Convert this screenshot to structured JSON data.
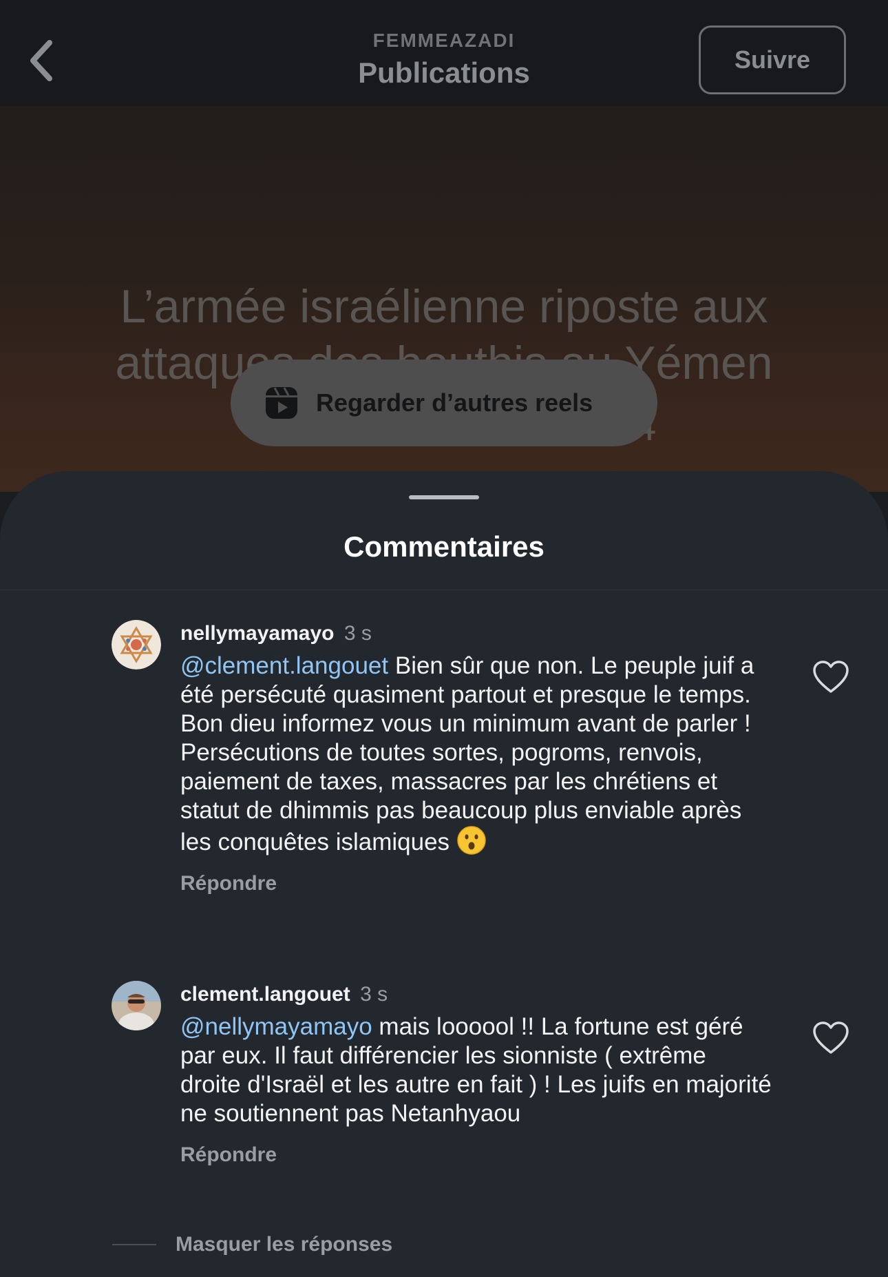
{
  "header": {
    "back_icon": "chevron-left-icon",
    "account": "FEMMEAZADI",
    "title": "Publications",
    "follow_label": "Suivre"
  },
  "video": {
    "caption_line1": "L’armée israélienne riposte aux",
    "caption_line2": "attaques des houthis au Yémen",
    "caption_extra": "4",
    "reels_icon": "reels-icon",
    "reels_label": "Regarder d’autres reels"
  },
  "comments_sheet": {
    "title": "Commentaires",
    "comments": [
      {
        "username": "nellymayamayo",
        "time": "3 s",
        "mention": "@clement.langouet",
        "text": "Bien sûr que non. Le peuple juif a été persécuté quasiment partout et presque le temps. Bon dieu informez vous un minimum avant de parler ! Persécutions de toutes sortes, pogroms, renvois, paiement de taxes, massacres par les chrétiens et statut de dhimmis pas beaucoup plus enviable après les conquêtes islamiques",
        "emoji": "astonished-face-emoji",
        "reply_label": "Répondre",
        "like_icon": "heart-icon"
      },
      {
        "username": "clement.langouet",
        "time": "3 s",
        "mention": "@nellymayamayo",
        "text": "mais loooool !! La fortune est géré par eux. Il faut différencier les sionniste ( extrême droite d'Israël et les autre en fait ) ! Les juifs en majorité ne soutiennent pas Netanhyaou",
        "reply_label": "Répondre",
        "like_icon": "heart-icon"
      }
    ],
    "hide_replies_label": "Masquer les réponses"
  }
}
